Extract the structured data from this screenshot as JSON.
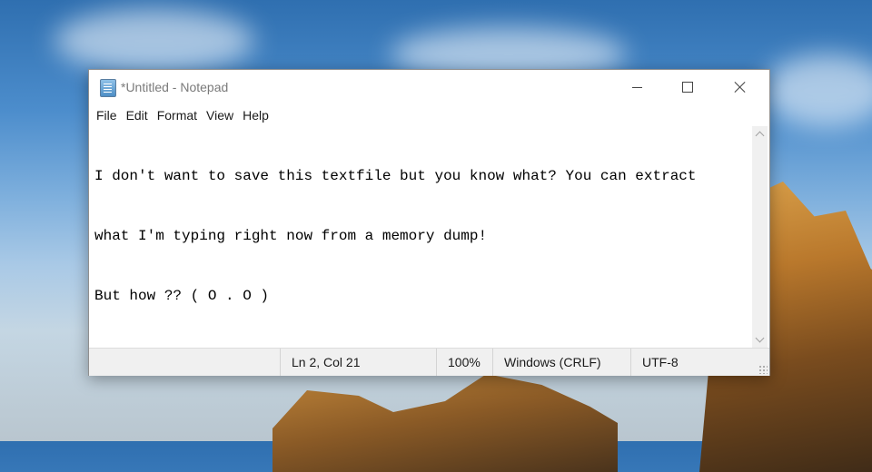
{
  "window": {
    "title": "*Untitled - Notepad",
    "app_icon": "notepad-icon"
  },
  "caption_buttons": {
    "minimize_icon": "minimize-icon",
    "maximize_icon": "maximize-icon",
    "close_icon": "close-icon"
  },
  "menu": {
    "items": [
      {
        "label": "File"
      },
      {
        "label": "Edit"
      },
      {
        "label": "Format"
      },
      {
        "label": "View"
      },
      {
        "label": "Help"
      }
    ]
  },
  "editor": {
    "lines": [
      "I don't want to save this textfile but you know what? You can extract",
      "what I'm typing right now from a memory dump!",
      "But how ?? ( O . O )"
    ]
  },
  "status": {
    "position": "Ln 2, Col 21",
    "zoom": "100%",
    "line_ending": "Windows (CRLF)",
    "encoding": "UTF-8"
  },
  "colors": {
    "text": "#000000",
    "title_text": "#7a7a7a",
    "statusbar_bg": "#f0f0f0"
  }
}
